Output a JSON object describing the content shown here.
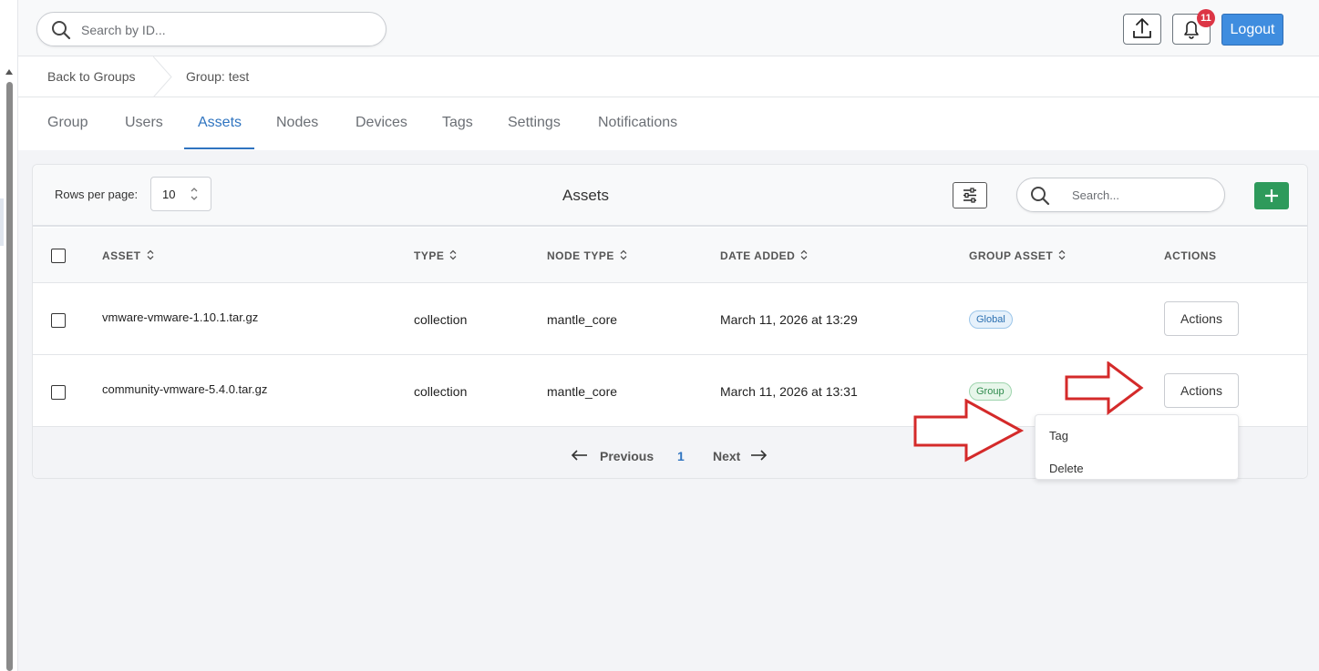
{
  "header": {
    "search_placeholder": "Search by ID...",
    "notification_count": "11",
    "logout_label": "Logout"
  },
  "breadcrumb": {
    "back": "Back to Groups",
    "current": "Group: test"
  },
  "tabs": [
    "Group",
    "Users",
    "Assets",
    "Nodes",
    "Devices",
    "Tags",
    "Settings",
    "Notifications"
  ],
  "active_tab": "Assets",
  "card": {
    "rows_per_page_label": "Rows per page:",
    "rows_per_page_value": "10",
    "title": "Assets",
    "search_placeholder": "Search..."
  },
  "table": {
    "headers": [
      "ASSET",
      "TYPE",
      "NODE TYPE",
      "DATE ADDED",
      "GROUP ASSET",
      "ACTIONS"
    ],
    "rows": [
      {
        "asset": "vmware-vmware-1.10.1.tar.gz",
        "type": "collection",
        "node_type": "mantle_core",
        "date_added": "March 11, 2026 at 13:29",
        "group_asset": "Global",
        "action": "Actions"
      },
      {
        "asset": "community-vmware-5.4.0.tar.gz",
        "type": "collection",
        "node_type": "mantle_core",
        "date_added": "March 11, 2026 at 13:31",
        "group_asset": "Group",
        "action": "Actions"
      }
    ]
  },
  "pagination": {
    "previous": "Previous",
    "page": "1",
    "next": "Next"
  },
  "dropdown": {
    "items": [
      "Tag",
      "Delete"
    ]
  },
  "colors": {
    "accent": "#2f74c0",
    "logout": "#3f8ddf",
    "add": "#2e9a5b",
    "badge": "#dc3545",
    "annotation_arrow": "#d42a2a"
  }
}
